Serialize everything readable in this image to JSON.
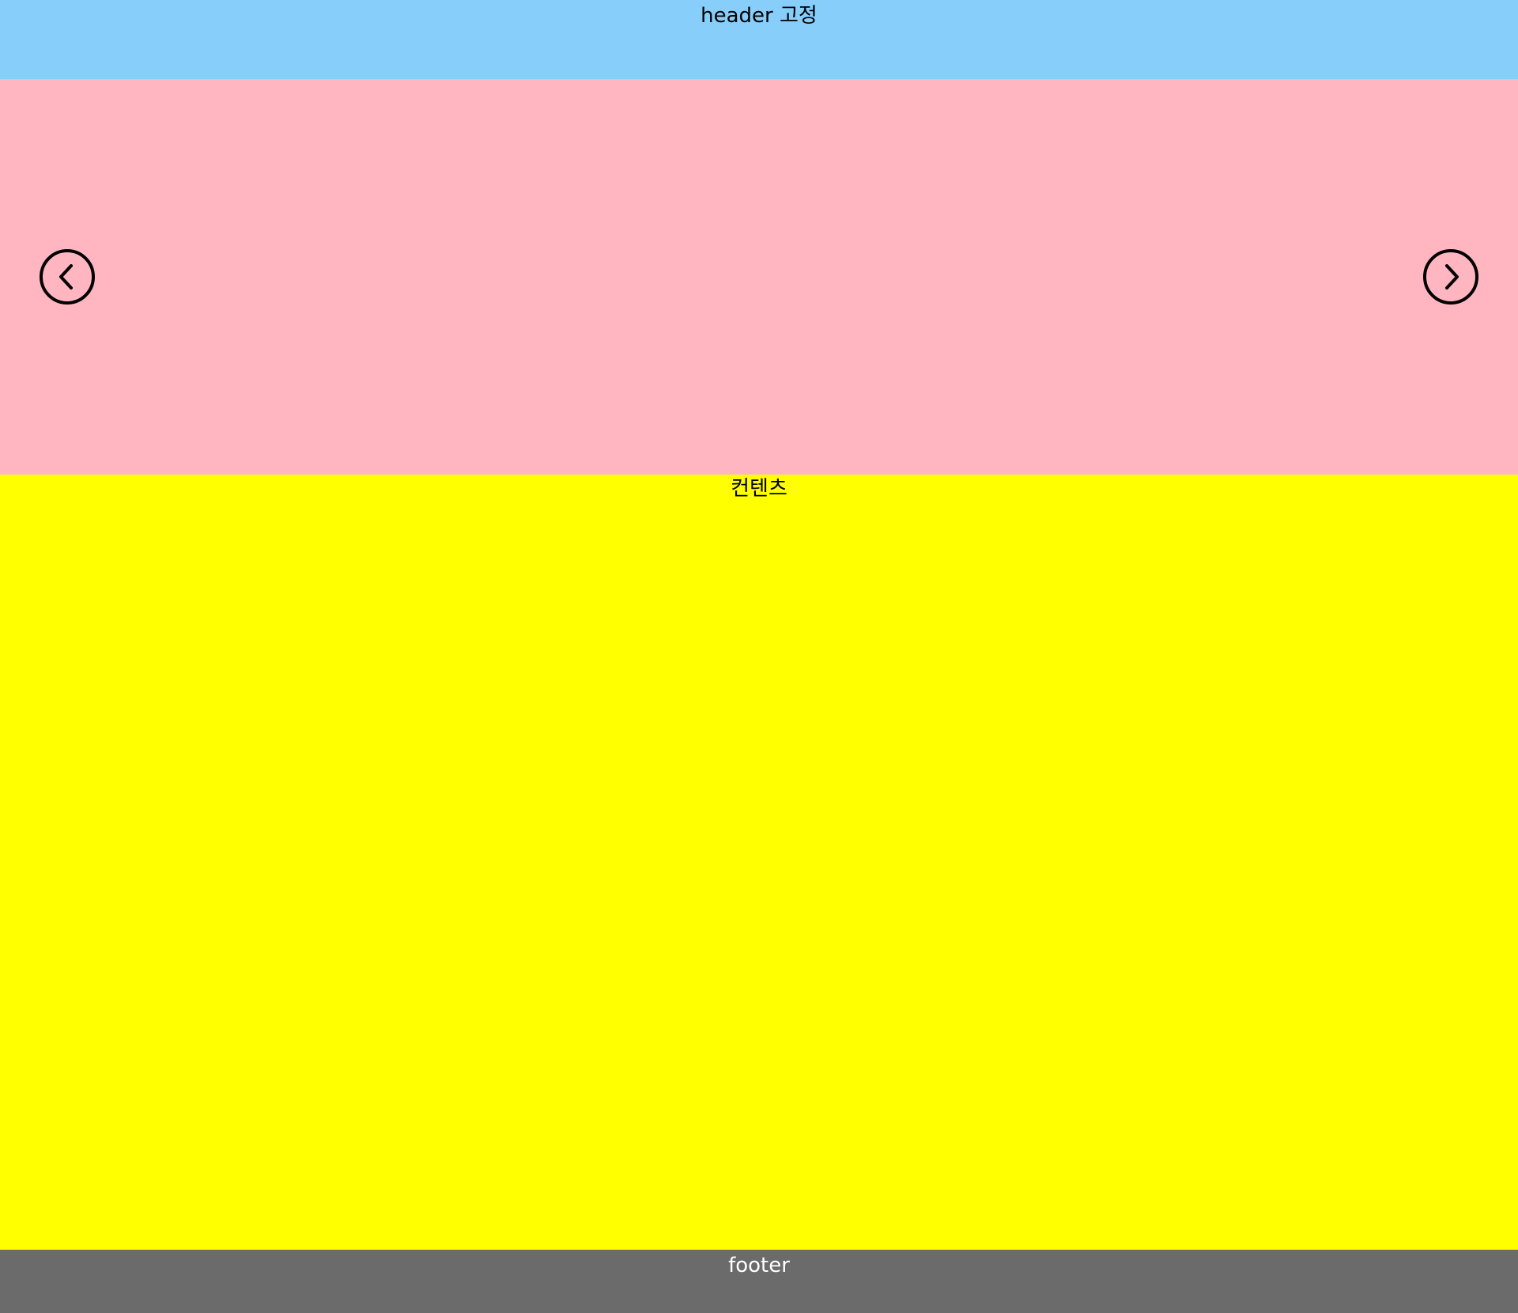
{
  "header": {
    "title": "header 고정",
    "background": "#87cefa"
  },
  "slider": {
    "background": "#ffb6c1",
    "prev_icon": "chevron-left-circle-icon",
    "next_icon": "chevron-right-circle-icon"
  },
  "content": {
    "title": "컨텐츠",
    "background": "#ffff00"
  },
  "footer": {
    "title": "footer",
    "background": "#6b6b6b",
    "text_color": "#ffffff"
  }
}
